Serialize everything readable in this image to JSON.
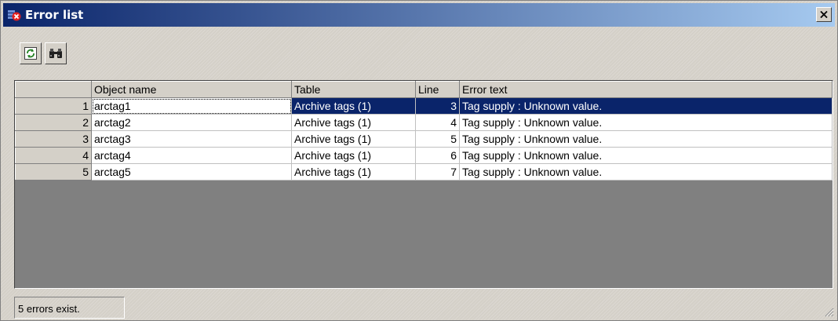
{
  "window": {
    "title": "Error list",
    "close_symbol": "✕"
  },
  "toolbar": {
    "buttons": [
      {
        "icon": "refresh-icon"
      },
      {
        "icon": "binoculars-icon"
      }
    ]
  },
  "grid": {
    "columns": [
      "",
      "Object name",
      "Table",
      "Line",
      "Error text"
    ],
    "rows": [
      {
        "num": "1",
        "object": "arctag1",
        "table": "Archive tags (1)",
        "line": "3",
        "error": "Tag supply : Unknown value."
      },
      {
        "num": "2",
        "object": "arctag2",
        "table": "Archive tags (1)",
        "line": "4",
        "error": "Tag supply : Unknown value."
      },
      {
        "num": "3",
        "object": "arctag3",
        "table": "Archive tags (1)",
        "line": "5",
        "error": "Tag supply : Unknown value."
      },
      {
        "num": "4",
        "object": "arctag4",
        "table": "Archive tags (1)",
        "line": "6",
        "error": "Tag supply : Unknown value."
      },
      {
        "num": "5",
        "object": "arctag5",
        "table": "Archive tags (1)",
        "line": "7",
        "error": "Tag supply : Unknown value."
      }
    ],
    "selected_row": 0
  },
  "status": {
    "text": "5 errors exist."
  },
  "colors": {
    "titlebar_start": "#0a246a",
    "titlebar_end": "#a6caf0",
    "selection": "#0a246a",
    "grid_background": "#808080"
  }
}
